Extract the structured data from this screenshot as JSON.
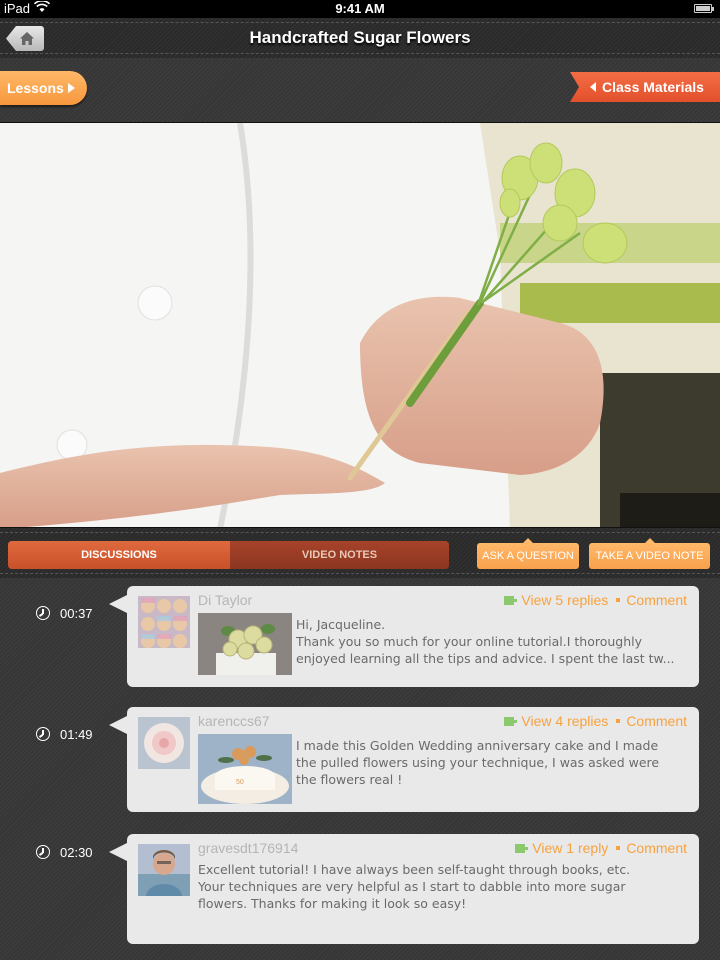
{
  "status_bar": {
    "carrier": "iPad",
    "time": "9:41 AM",
    "wifi_icon": "wifi-icon",
    "battery_icon": "battery-icon"
  },
  "nav": {
    "title": "Handcrafted Sugar Flowers",
    "home_icon": "home-icon"
  },
  "toolbar": {
    "lessons_label": "Lessons",
    "class_materials_label": "Class Materials"
  },
  "video": {
    "description": "Instructor in white chef jacket holding a stem of pale green sugar sweet peas on a wooden skewer"
  },
  "tabs": [
    {
      "label": "DISCUSSIONS",
      "active": true
    },
    {
      "label": "VIDEO NOTES",
      "active": false
    }
  ],
  "actions": {
    "ask_question": "ASK A QUESTION",
    "take_note": "TAKE A VIDEO NOTE"
  },
  "colors": {
    "accent_orange": "#f7a23e",
    "tab_active": "#d75d33",
    "class_materials": "#ea5a35",
    "reply_flag": "#8cc86e"
  },
  "discussions": [
    {
      "timestamp": "00:37",
      "user": "Di Taylor",
      "replies_label": "View 5 replies",
      "comment_label": "Comment",
      "has_attachment": true,
      "lines": [
        "Hi, Jacqueline.",
        "Thank you so much for your online tutorial.I thoroughly",
        "enjoyed learning all the tips and advice. I spent the last tw..."
      ]
    },
    {
      "timestamp": "01:49",
      "user": "karenccs67",
      "replies_label": "View 4 replies",
      "comment_label": "Comment",
      "has_attachment": true,
      "lines": [
        "I made this Golden Wedding anniversary cake and I made",
        "the pulled flowers using your technique, I was asked were",
        "the flowers real !"
      ]
    },
    {
      "timestamp": "02:30",
      "user": "gravesdt176914",
      "replies_label": "View 1 reply",
      "comment_label": "Comment",
      "has_attachment": false,
      "lines": [
        "Excellent tutorial!  I have always been self-taught  through books, etc.",
        "Your techniques are very helpful as I start to dabble into more sugar",
        "flowers.  Thanks for making it look so easy!"
      ]
    }
  ]
}
